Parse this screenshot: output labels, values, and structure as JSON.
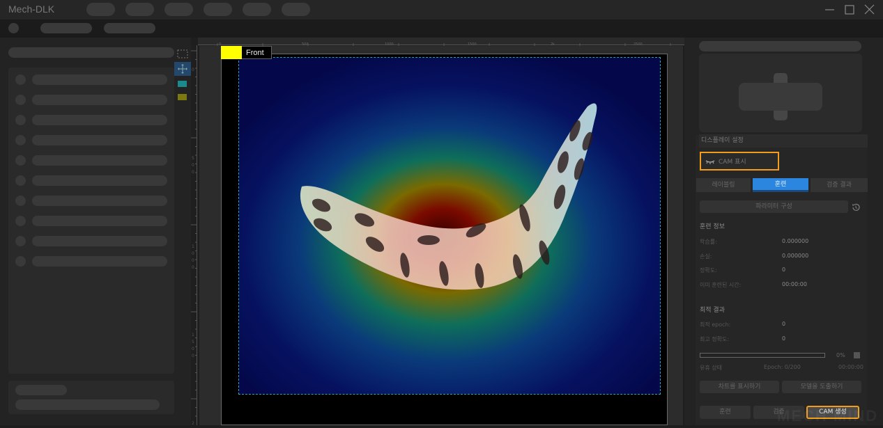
{
  "app": {
    "title": "Mech-DLK"
  },
  "window_controls": {
    "minimize": "minimize-icon",
    "maximize": "maximize-icon",
    "close": "close-icon"
  },
  "canvas": {
    "view_label": "Front",
    "view_color": "#ffff00",
    "ruler_top_labels": [
      "0",
      "500",
      "1000",
      "1500",
      "2k",
      "2500"
    ],
    "ruler_left_labels": [
      "0",
      "500",
      "1000",
      "1500",
      "2"
    ],
    "overlay": "CAM heatmap"
  },
  "tools": [
    {
      "name": "select-rect-icon"
    },
    {
      "name": "move-icon",
      "active": true
    },
    {
      "name": "color-swatch-cyan",
      "color": "#1a8a8c"
    },
    {
      "name": "color-swatch-yellow",
      "color": "#7a7a10"
    }
  ],
  "right_panel": {
    "display_settings_title": "디스플레이 설정",
    "cam_toggle_label": "CAM 표시",
    "tabs": [
      {
        "label": "레이블링",
        "active": false
      },
      {
        "label": "훈련",
        "active": true
      },
      {
        "label": "검증 결과",
        "active": false
      }
    ],
    "param_button": "파라미터 구성",
    "training_info": {
      "title": "훈련 정보",
      "rows": [
        {
          "key": "학습률:",
          "value": "0.000000"
        },
        {
          "key": "손실:",
          "value": "0.000000"
        },
        {
          "key": "정확도:",
          "value": "0"
        },
        {
          "key": "이미 훈련된 시간:",
          "value": "00:00:00"
        }
      ]
    },
    "best_result": {
      "title": "최적 결과",
      "rows": [
        {
          "key": "최적 epoch:",
          "value": "0"
        },
        {
          "key": "최고 정확도:",
          "value": "0"
        }
      ]
    },
    "progress": {
      "percent": 0,
      "label": "0%"
    },
    "status": {
      "state": "유휴 상태",
      "epoch": "Epoch: 0/200",
      "time": "00:00:00"
    },
    "action_buttons": {
      "show_chart": "차트를 표시하기",
      "export_model": "모델을 도출하기"
    },
    "bottom_buttons": {
      "train": "훈련",
      "validate": "검증",
      "generate_cam": "CAM 생성"
    },
    "accent_color": "#f29d1c",
    "tab_active_color": "#2b86e0"
  },
  "watermark": "MECH MIND"
}
